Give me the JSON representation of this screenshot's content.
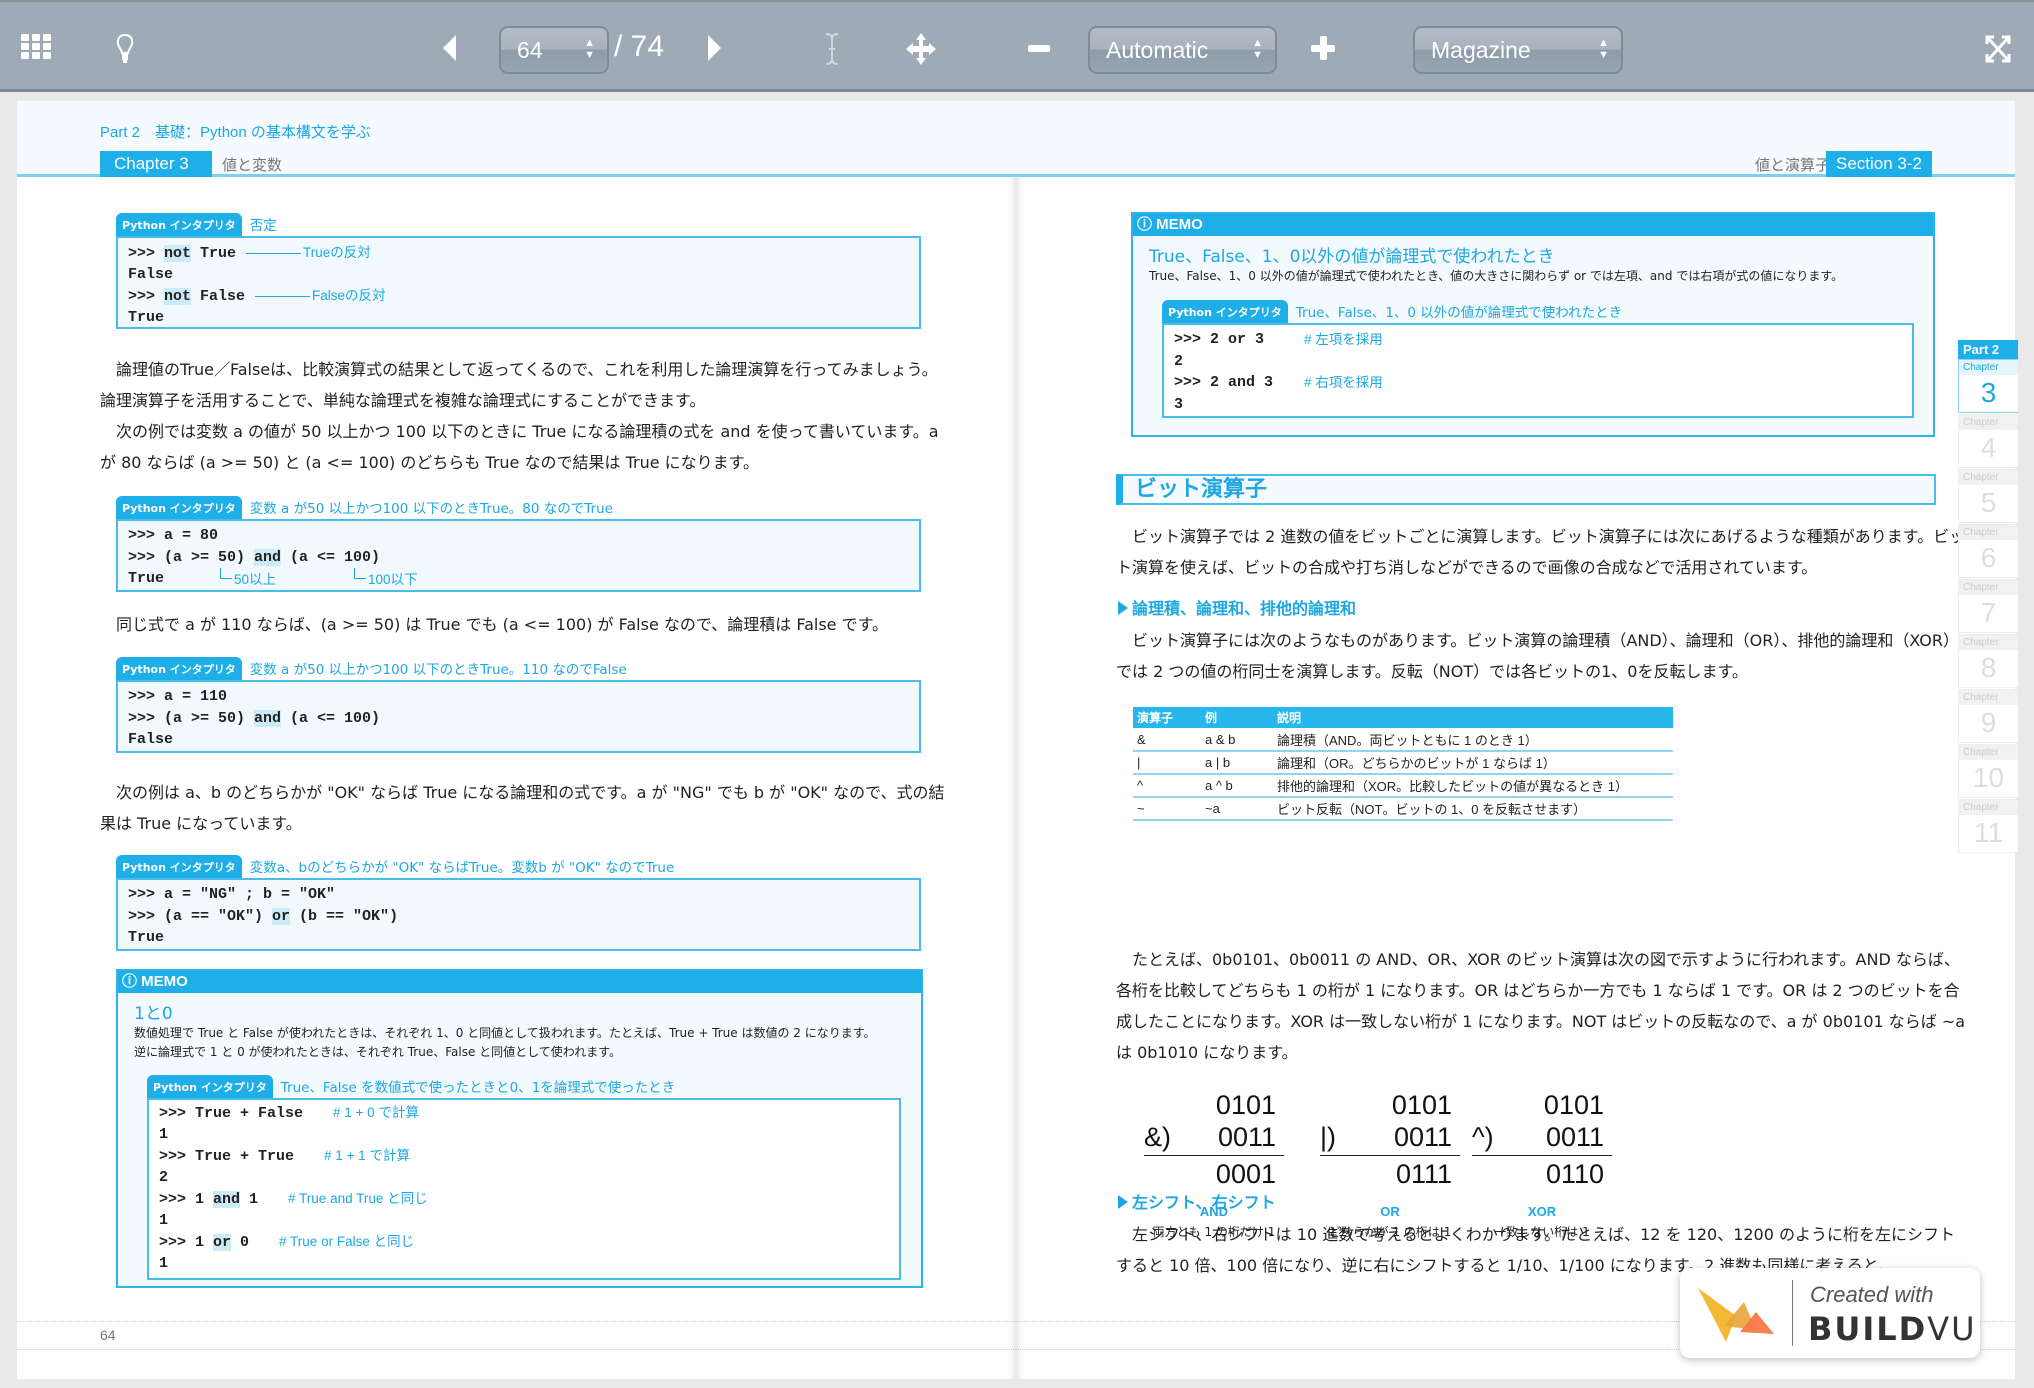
{
  "toolbar": {
    "current_page": "64",
    "total_pages": "/ 74",
    "zoom_mode": "Automatic",
    "view_mode": "Magazine",
    "icons": [
      "thumbnails-grid-icon",
      "lightbulb-icon",
      "prev-page-icon",
      "next-page-icon",
      "text-select-icon",
      "pan-move-icon",
      "zoom-out-icon",
      "zoom-in-icon",
      "fullscreen-icon"
    ]
  },
  "left_page": {
    "part_line": "Part 2　基礎：Python の基本構文を学ぶ",
    "chapter_tab": "Chapter 3",
    "chapter_name": "値と変数",
    "page_number": "64",
    "code1": {
      "tag": "Python インタプリタ",
      "caption": "否定",
      "lines": [
        {
          "pre": ">>> ",
          "kw": "not",
          "post": " True",
          "note": "Trueの反対"
        },
        {
          "pre": "False"
        },
        {
          "pre": ">>> ",
          "kw": "not",
          "post": " False",
          "note": "Falseの反対"
        },
        {
          "pre": "True"
        }
      ]
    },
    "para1": [
      "論理値のTrue／Falseは、比較演算式の結果として返ってくるので、これを利用した論理演算を行ってみましょう。論理演算子を活用することで、単純な論理式を複雑な論理式にすることができます。",
      "次の例では変数 a の値が 50 以上かつ 100 以下のときに True になる論理積の式を and を使って書いています。a が 80 ならば (a >= 50) と (a <= 100) のどちらも True なので結果は True になります。"
    ],
    "code2": {
      "tag": "Python インタプリタ",
      "caption": "変数 a が50 以上かつ100 以下のときTrue。80 なのでTrue",
      "line1": ">>> a = 80",
      "line2_pre": ">>> (a >= 50) ",
      "line2_kw": "and",
      "line2_post": " (a <= 100)",
      "line3": "True",
      "note1": "50以上",
      "note2": "100以下"
    },
    "para2": "同じ式で a が 110 ならば、(a >= 50) は True でも (a <= 100) が False なので、論理積は False です。",
    "code3": {
      "tag": "Python インタプリタ",
      "caption": "変数 a が50 以上かつ100 以下のときTrue。110 なのでFalse",
      "line1": ">>> a = 110",
      "line2_pre": ">>> (a >= 50) ",
      "line2_kw": "and",
      "line2_post": " (a <= 100)",
      "line3": "False"
    },
    "para3": "次の例は a、b のどちらかが \"OK\" ならば True になる論理和の式です。a が \"NG\" でも b が \"OK\" なので、式の結果は True になっています。",
    "code4": {
      "tag": "Python インタプリタ",
      "caption": "変数a、bのどちらかが \"OK\" ならばTrue。変数b が \"OK\" なのでTrue",
      "line1": ">>> a = \"NG\" ; b = \"OK\"",
      "line2_pre": ">>> (a == \"OK\") ",
      "line2_kw": "or",
      "line2_post": " (b == \"OK\")",
      "line3": "True"
    },
    "memo": {
      "head": "MEMO",
      "title": "1と0",
      "text1": "数値処理で True と False が使われたときは、それぞれ 1、0 と同値として扱われます。たとえば、True + True は数値の 2 になります。",
      "text2": "逆に論理式で 1 と 0 が使われたときは、それぞれ True、False と同値として使われます。",
      "tag": "Python インタプリタ",
      "caption": "True、False を数値式で使ったときと0、1を論理式で使ったとき",
      "lines": [
        {
          "pre": ">>> True + False",
          "note": "# 1 + 0 で計算"
        },
        {
          "pre": "1"
        },
        {
          "pre": ">>> True + True",
          "note": "# 1 + 1 で計算"
        },
        {
          "pre": "2"
        },
        {
          "pre": ">>> 1 ",
          "kw": "and",
          "post": " 1",
          "note": "# True and True と同じ"
        },
        {
          "pre": "1"
        },
        {
          "pre": ">>> 1 ",
          "kw": "or",
          "post": " 0",
          "note": "# True or False と同じ"
        },
        {
          "pre": "1"
        }
      ]
    }
  },
  "right_page": {
    "section_name": "値と演算子",
    "section_tab": "Section 3-2",
    "memo": {
      "head": "MEMO",
      "title": "True、False、1、0以外の値が論理式で使われたとき",
      "text": "True、False、1、0 以外の値が論理式で使われたとき、値の大きさに関わらず or では左項、and では右項が式の値になります。",
      "tag": "Python インタプリタ",
      "caption": "True、False、1、0 以外の値が論理式で使われたとき",
      "lines": [
        {
          "pre": ">>> 2 or 3",
          "note": "# 左項を採用"
        },
        {
          "pre": "2"
        },
        {
          "pre": ">>> 2 and 3",
          "note": "# 右項を採用"
        },
        {
          "pre": "3"
        }
      ]
    },
    "heading": "ビット演算子",
    "para1": "ビット演算子では 2 進数の値をビットごとに演算します。ビット演算子には次にあげるような種類があります。ビット演算を使えば、ビットの合成や打ち消しなどができるので画像の合成などで活用されています。",
    "sub1": "論理積、論理和、排他的論理和",
    "para2": "ビット演算子には次のようなものがあります。ビット演算の論理積（AND）、論理和（OR）、排他的論理和（XOR）では 2 つの値の桁同士を演算します。反転（NOT）では各ビットの1、0を反転します。",
    "table": {
      "headers": [
        "演算子",
        "例",
        "説明"
      ],
      "rows": [
        [
          "&",
          "a & b",
          "論理積（AND。両ビットともに 1 のとき 1）"
        ],
        [
          "|",
          "a | b",
          "論理和（OR。どちらかのビットが 1 ならば 1）"
        ],
        [
          "^",
          "a ^ b",
          "排他的論理和（XOR。比較したビットの値が異なるとき 1）"
        ],
        [
          "~",
          "~a",
          "ビット反転（NOT。ビットの 1、0 を反転させます）"
        ]
      ]
    },
    "para3": "たとえば、0b0101、0b0011 の AND、OR、XOR のビット演算は次の図で示すように行われます。AND ならば、各桁を比較してどちらも 1 の桁が 1 になります。OR はどちらか一方でも 1 ならば 1 です。OR は 2 つのビットを合成したことになります。XOR は一致しない桁が 1 になります。NOT はビットの反転なので、a が 0b0101 ならば ~a は 0b1010 になります。",
    "diagrams": [
      {
        "a": "0101",
        "op": "&)",
        "b": "0011",
        "result": "0001",
        "label": "AND",
        "desc": "両方とも 1 の桁だけ 1"
      },
      {
        "a": "0101",
        "op": "|)",
        "b": "0011",
        "result": "0111",
        "label": "OR",
        "desc": "どちらかが 1 の桁は 1"
      },
      {
        "a": "0101",
        "op": "^)",
        "b": "0011",
        "result": "0110",
        "label": "XOR",
        "desc": "一致しない桁は 1"
      }
    ],
    "sub2": "左シフト、右シフト",
    "para4": "左シフト、右シフトは 10 進数で考えるとよくわかります。たとえば、12 を 120、1200 のように桁を左にシフトすると 10 倍、100 倍になり、逆に右にシフトすると 1/10、1/100 になります。2 進数も同様に考えると、"
  },
  "chapter_nav": {
    "part": "Part 2",
    "chapter_label": "Chapter",
    "chapters": [
      "3",
      "4",
      "5",
      "6",
      "7",
      "8",
      "9",
      "10",
      "11"
    ],
    "active": "3"
  },
  "watermark": {
    "created_with": "Created with",
    "brand_bold": "BUILD",
    "brand_light": "VU"
  },
  "colors": {
    "accent": "#1eaee8",
    "toolbar": "#9eabb7"
  }
}
